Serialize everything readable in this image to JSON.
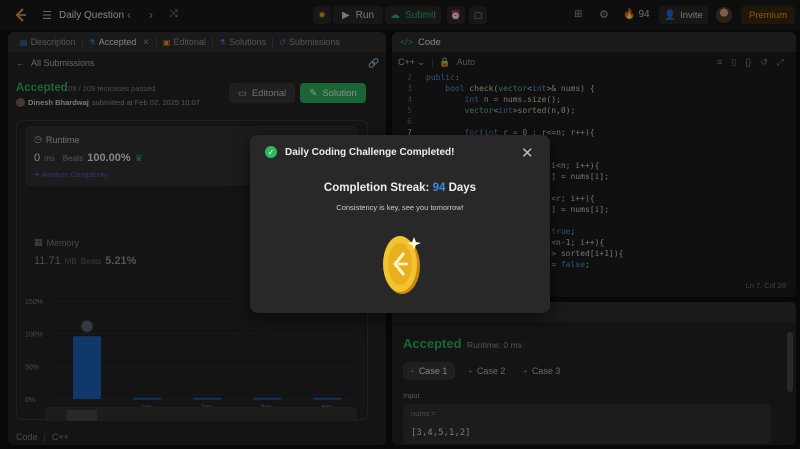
{
  "topbar": {
    "title": "Daily Question",
    "run_label": "Run",
    "submit_label": "Submit",
    "streak_count": "94",
    "invite_label": "Invite",
    "premium_label": "Premium"
  },
  "left_panel": {
    "tabs": [
      {
        "label": "Description"
      },
      {
        "label": "Accepted"
      },
      {
        "label": "Editorial"
      },
      {
        "label": "Solutions"
      },
      {
        "label": "Submissions"
      }
    ],
    "back_label": "All Submissions",
    "status": "Accepted",
    "testcases": "109 / 109 testcases passed",
    "author": "Dinesh Bhardwaj",
    "submitted": "submitted at Feb 02, 2025 10:07",
    "editorial_button": "Editorial",
    "solution_button": "Solution",
    "runtime": {
      "label": "Runtime",
      "value": "0",
      "unit": "ms",
      "beats_label": "Beats",
      "beats_pct": "100.00%",
      "analyze_label": "Analyze Complexity"
    },
    "memory": {
      "label": "Memory",
      "value": "11.71",
      "unit": "MB",
      "beats_label": "Beats",
      "beats_pct": "5.21%"
    },
    "footer_code": "Code",
    "footer_lang": "C++"
  },
  "chart_data": {
    "type": "bar",
    "y_ticks": [
      "150%",
      "100%",
      "50%",
      "0%"
    ],
    "ylim": [
      0,
      150
    ],
    "categories": [
      "",
      "1ms",
      "2ms",
      "3ms",
      "4ms"
    ],
    "values": [
      96,
      2,
      2,
      2,
      2
    ],
    "mini_ticks": [
      "1ms",
      "2ms",
      "3ms",
      "4ms"
    ],
    "bar_color": "#1a5fb4",
    "highlight_color": "#2066c2"
  },
  "editor": {
    "header": "Code",
    "lang": "C++",
    "mode": "Auto",
    "lines": [
      {
        "n": "2",
        "t": "public:"
      },
      {
        "n": "3",
        "t": "    bool check(vector<int>& nums) {"
      },
      {
        "n": "4",
        "t": "        int n = nums.size();"
      },
      {
        "n": "5",
        "t": "        vector<int>sorted(n,0);"
      },
      {
        "n": "6",
        "t": ""
      },
      {
        "n": "7",
        "t": "        for(int r = 0 ; r<=n; r++){"
      },
      {
        "n": "8",
        "t": ""
      },
      {
        "n": "9",
        "t": ""
      },
      {
        "n": "10",
        "t": "                          i<n; i++){"
      },
      {
        "n": "11",
        "t": "                          ] = nums[i];"
      },
      {
        "n": "12",
        "t": ""
      },
      {
        "n": "13",
        "t": "                          <r; i++){"
      },
      {
        "n": "14",
        "t": "                          ] = nums[i];"
      },
      {
        "n": "15",
        "t": ""
      },
      {
        "n": "16",
        "t": "                          true;"
      },
      {
        "n": "17",
        "t": "                          <n-1; i++){"
      },
      {
        "n": "18",
        "t": "                          > sorted[i+1]){"
      },
      {
        "n": "19",
        "t": "                          = false;"
      }
    ],
    "cursor": "Ln 7, Col 28"
  },
  "bottom_panel": {
    "accepted": "Accepted",
    "runtime": "Runtime: 0 ms",
    "cases": [
      {
        "label": "Case 1"
      },
      {
        "label": "Case 2"
      },
      {
        "label": "Case 3"
      }
    ],
    "input_label": "Input",
    "input_name": "nums =",
    "input_value": "[3,4,5,1,2]"
  },
  "modal": {
    "title": "Daily Coding Challenge Completed!",
    "streak_prefix": "Completion Streak:",
    "streak_days": "94",
    "streak_suffix": "Days",
    "subtitle": "Consistency is key, see you tomorrow!"
  },
  "colors": {
    "accent_green": "#2cbb5d",
    "accent_orange": "#ffa116",
    "streak_blue": "#3a8ee6",
    "coin_gold": "#f4c430"
  }
}
